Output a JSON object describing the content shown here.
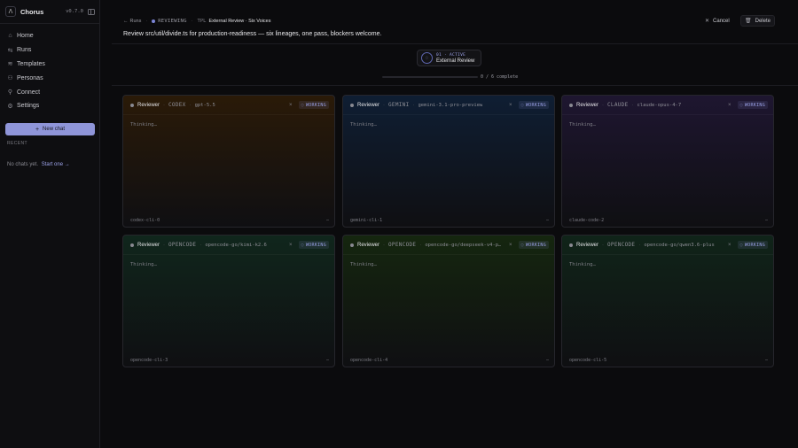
{
  "sidebar": {
    "brand_name": "Chorus",
    "version": "v0.7.0",
    "nav": [
      {
        "label": "Home",
        "icon": "home-icon",
        "glyph": "⌂"
      },
      {
        "label": "Runs",
        "icon": "runs-icon",
        "glyph": "⇆"
      },
      {
        "label": "Templates",
        "icon": "templates-icon",
        "glyph": "≋"
      },
      {
        "label": "Personas",
        "icon": "personas-icon",
        "glyph": "⚇"
      },
      {
        "label": "Connect",
        "icon": "connect-icon",
        "glyph": "⚲"
      },
      {
        "label": "Settings",
        "icon": "gear-icon",
        "glyph": "⚙"
      }
    ],
    "new_chat": "New chat",
    "recent_label": "RECENT",
    "empty_text": "No chats yet.",
    "empty_link": "Start one →"
  },
  "header": {
    "back_label": "Runs",
    "status": "REVIEWING",
    "tpl_label": "TPL",
    "tpl_name": "External Review · Six Voices",
    "cancel": "Cancel",
    "delete": "Delete",
    "prompt": "Review src/util/divide.ts for production-readiness — six lineages, one pass, blockers welcome."
  },
  "stage": {
    "number": "01 · ACTIVE",
    "name": "External Review"
  },
  "progress": {
    "text": "0 / 6 complete",
    "fraction": 0
  },
  "accent": "#8f95d9",
  "cards": [
    {
      "role": "Reviewer",
      "lineage": "CODEX",
      "model": "gpt-5.5",
      "status": "WORKING",
      "body": "Thinking…",
      "footer": "codex-cli-0",
      "tint": "#2a1a08"
    },
    {
      "role": "Reviewer",
      "lineage": "GEMINI",
      "model": "gemini-3.1-pro-preview",
      "status": "WORKING",
      "body": "Thinking…",
      "footer": "gemini-cli-1",
      "tint": "#0f1e33"
    },
    {
      "role": "Reviewer",
      "lineage": "CLAUDE",
      "model": "claude-opus-4-7",
      "status": "WORKING",
      "body": "Thinking…",
      "footer": "claude-code-2",
      "tint": "#1e1630"
    },
    {
      "role": "Reviewer",
      "lineage": "OPENCODE",
      "model": "opencode-go/kimi-k2.6",
      "status": "WORKING",
      "body": "Thinking…",
      "footer": "opencode-cli-3",
      "tint": "#10261c"
    },
    {
      "role": "Reviewer",
      "lineage": "OPENCODE",
      "model": "opencode-go/deepseek-v4-p…",
      "status": "WORKING",
      "body": "Thinking…",
      "footer": "opencode-cli-4",
      "tint": "#15260f"
    },
    {
      "role": "Reviewer",
      "lineage": "OPENCODE",
      "model": "opencode-go/qwen3.6-plus",
      "status": "WORKING",
      "body": "Thinking…",
      "footer": "opencode-cli-5",
      "tint": "#102419"
    }
  ]
}
